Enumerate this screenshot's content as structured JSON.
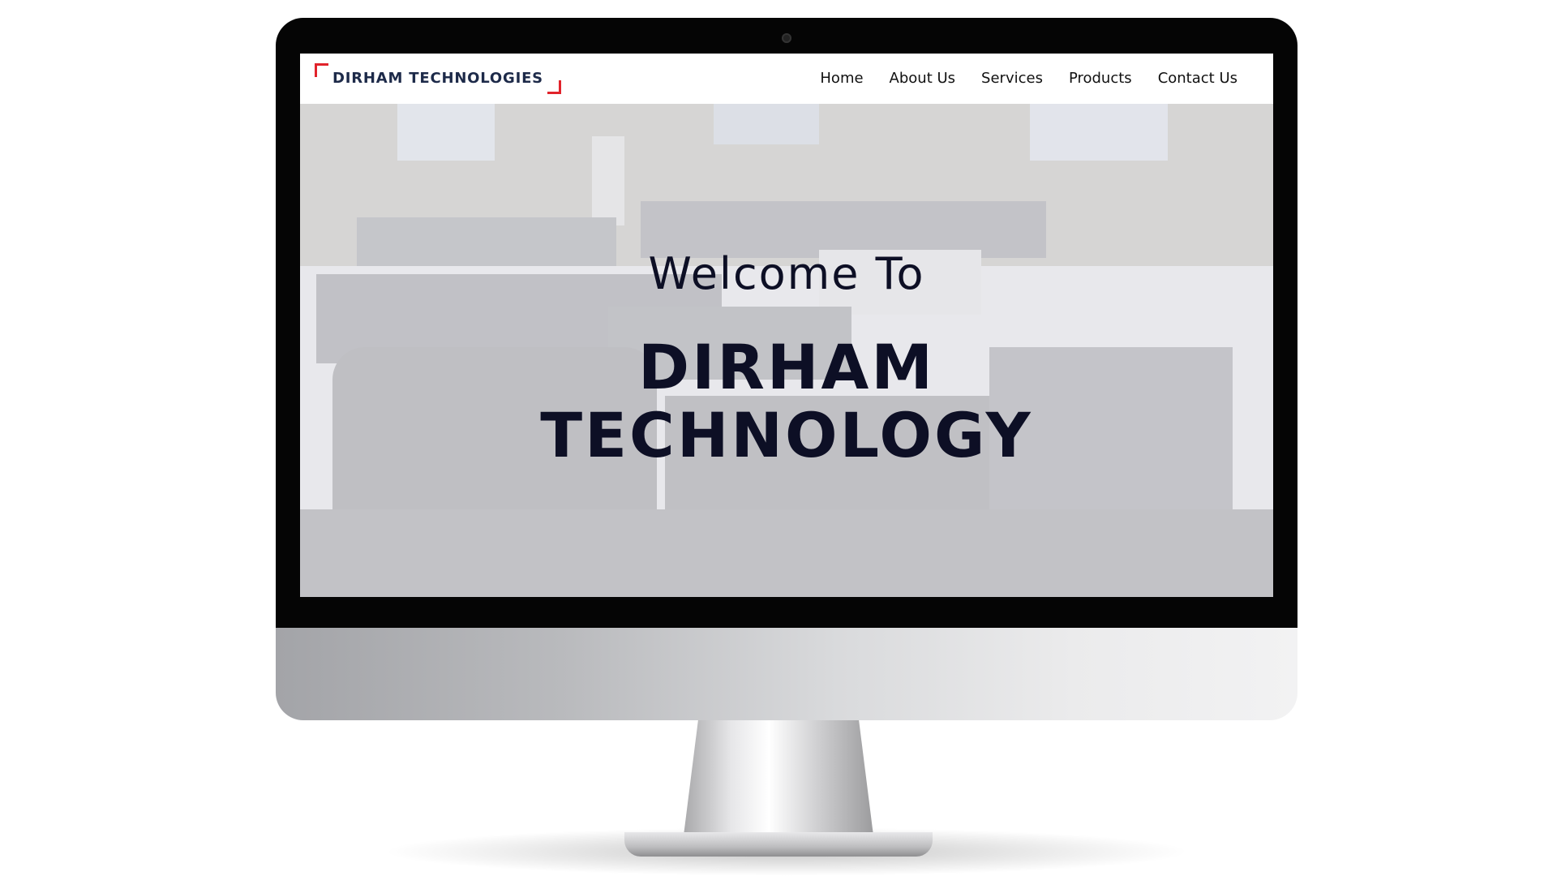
{
  "site": {
    "logo_text": "DIRHAM TECHNOLOGIES",
    "nav": [
      {
        "label": "Home"
      },
      {
        "label": "About Us"
      },
      {
        "label": "Services"
      },
      {
        "label": "Products"
      },
      {
        "label": "Contact Us"
      }
    ],
    "hero": {
      "welcome": "Welcome To",
      "title_line1": "DIRHAM",
      "title_line2": "TECHNOLOGY"
    }
  },
  "colors": {
    "logo_accent": "#e1232b",
    "logo_text": "#1d2a49",
    "hero_text": "#0d0f25",
    "bezel": "#050505"
  },
  "icons": [
    "webcam-icon"
  ]
}
